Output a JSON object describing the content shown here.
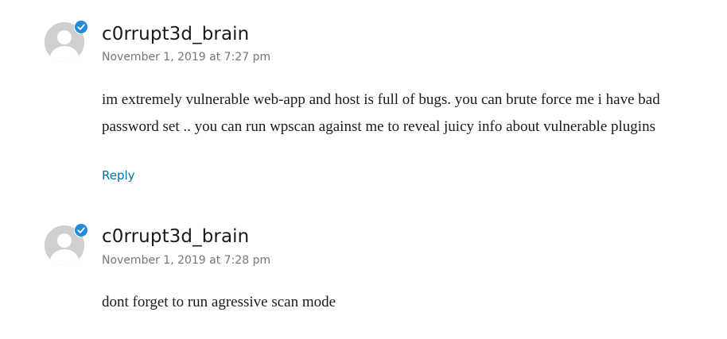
{
  "comments": [
    {
      "author": "c0rrupt3d_brain",
      "date": "November 1, 2019 at 7:27 pm",
      "text": "im extremely vulnerable web-app and host is full of bugs. you can brute force me i have bad password set .. you can run wpscan against me to reveal juicy info about vulnerable plugins",
      "reply_label": "Reply",
      "avatar_icon": "default-user-avatar-icon",
      "badge_icon": "verified-check-icon"
    },
    {
      "author": "c0rrupt3d_brain",
      "date": "November 1, 2019 at 7:28 pm",
      "text": "dont forget to run agressive scan mode",
      "avatar_icon": "default-user-avatar-icon",
      "badge_icon": "verified-check-icon"
    }
  ],
  "colors": {
    "link": "#0073aa",
    "badge": "#1e8cd8",
    "meta": "#767676",
    "avatar_bg": "#cfcfcf"
  }
}
